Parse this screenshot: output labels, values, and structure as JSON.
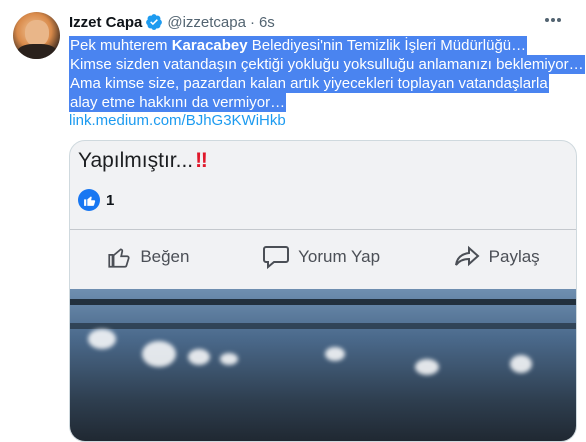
{
  "tweet": {
    "display_name": "Izzet Capa",
    "handle": "@izzetcapa",
    "dot": "·",
    "time": "6s",
    "text_lines": [
      {
        "pre": "Pek muhterem ",
        "bold": "Karacabey",
        "post": " Belediyesi'nin Temizlik İşleri Müdürlüğü…"
      },
      {
        "text": "Kimse sizden vatandaşın çektiği yokluğu yoksulluğu anlamanızı beklemiyor…"
      },
      {
        "text": "Ama kimse size, pazardan kalan artık yiyecekleri toplayan vatandaşlarla"
      },
      {
        "text": "alay etme hakkını da vermiyor…"
      }
    ],
    "link": "link.medium.com/BJhG3KWiHkb"
  },
  "embedded_post": {
    "title": "Yapılmıştır...",
    "title_marks": "‼",
    "like_count": "1",
    "actions": {
      "like_label": "Beğen",
      "comment_label": "Yorum Yap",
      "share_label": "Paylaş"
    }
  },
  "colors": {
    "selection": "#4a84f0",
    "link": "#1d9bf0",
    "verified": "#1d9bf0",
    "facebook_blue": "#1877f2"
  },
  "icons": [
    "verified-badge-icon",
    "more-options-icon",
    "thumbs-up-icon",
    "comment-bubble-icon",
    "share-arrow-icon"
  ]
}
